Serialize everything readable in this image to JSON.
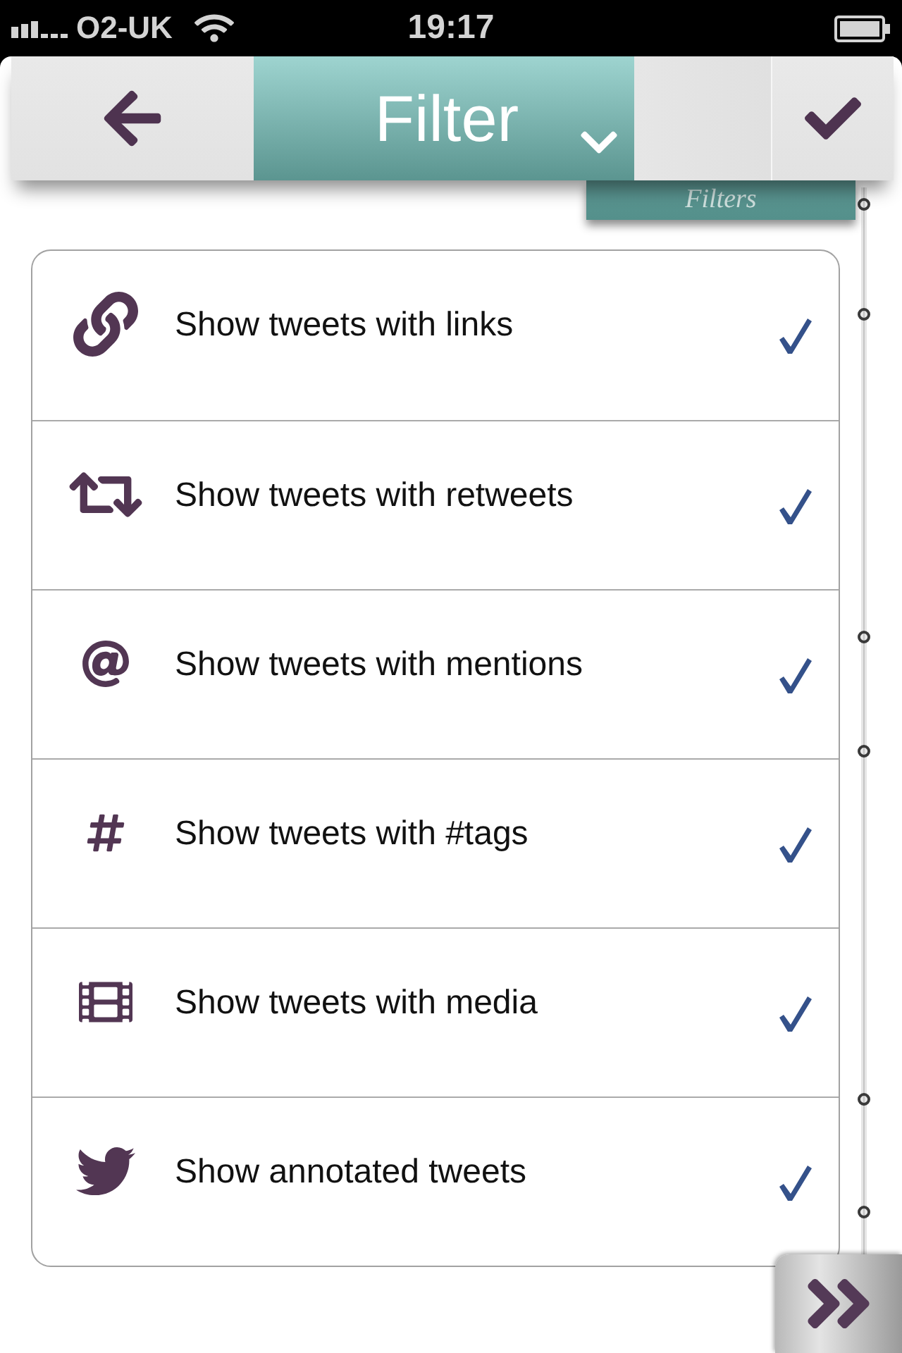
{
  "status_bar": {
    "carrier": "O2-UK",
    "time": "19:17"
  },
  "toolbar": {
    "title": "Filter",
    "tab_label": "Filters"
  },
  "filters": [
    {
      "kind": "link",
      "label": "Show tweets with links",
      "checked": true
    },
    {
      "kind": "retweet",
      "label": "Show tweets with retweets",
      "checked": true
    },
    {
      "kind": "mention",
      "label": "Show tweets with mentions",
      "checked": true
    },
    {
      "kind": "tag",
      "label": "Show tweets with #tags",
      "checked": true
    },
    {
      "kind": "media",
      "label": "Show tweets with media",
      "checked": true
    },
    {
      "kind": "annotation",
      "label": "Show annotated tweets",
      "checked": true
    }
  ]
}
